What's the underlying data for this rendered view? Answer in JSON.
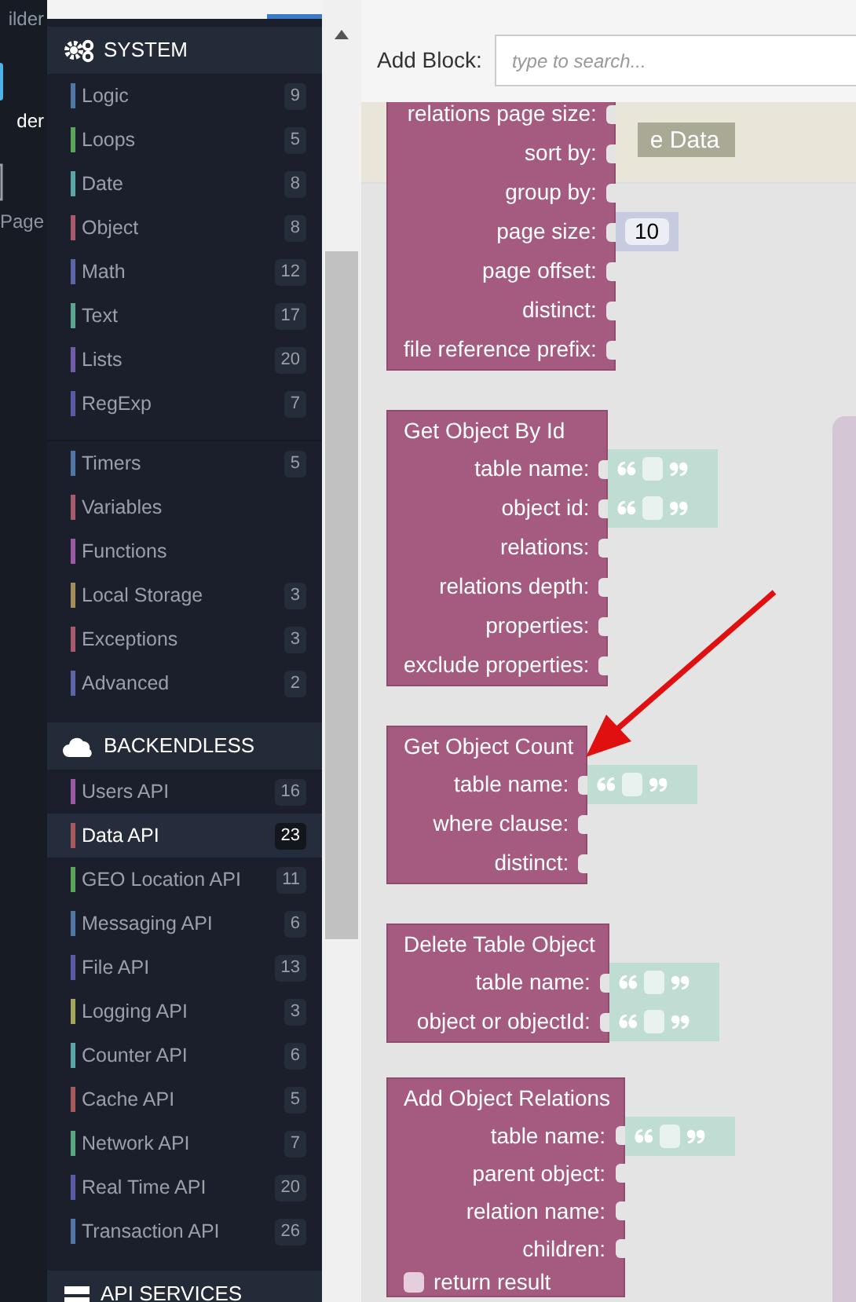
{
  "app_nav": [
    {
      "label": "ilder",
      "selected": false
    },
    {
      "label": "der",
      "selected": true
    },
    {
      "label": "Page",
      "selected": false
    }
  ],
  "sidebar": {
    "sections": [
      {
        "title": "SYSTEM",
        "groups": [
          [
            {
              "label": "Logic",
              "count": "9",
              "color": "#4f76a5",
              "selected": false
            },
            {
              "label": "Loops",
              "count": "5",
              "color": "#5ba55b",
              "selected": false
            },
            {
              "label": "Date",
              "count": "8",
              "color": "#5ba5a5",
              "selected": false
            },
            {
              "label": "Object",
              "count": "8",
              "color": "#a55b6b",
              "selected": false
            },
            {
              "label": "Math",
              "count": "12",
              "color": "#5b67a5",
              "selected": false
            },
            {
              "label": "Text",
              "count": "17",
              "color": "#5ba58c",
              "selected": false
            },
            {
              "label": "Lists",
              "count": "20",
              "color": "#745ba5",
              "selected": false
            },
            {
              "label": "RegExp",
              "count": "7",
              "color": "#5b5ba5",
              "selected": false
            }
          ],
          [
            {
              "label": "Timers",
              "count": "5",
              "color": "#4f76a5",
              "selected": false
            },
            {
              "label": "Variables",
              "color": "#a55b6b",
              "selected": false
            },
            {
              "label": "Functions",
              "color": "#9a5ba5",
              "selected": false
            },
            {
              "label": "Local Storage",
              "count": "3",
              "color": "#a58c5b",
              "selected": false
            },
            {
              "label": "Exceptions",
              "count": "3",
              "color": "#a55b6b",
              "selected": false
            },
            {
              "label": "Advanced",
              "count": "2",
              "color": "#5b67a5",
              "selected": false
            }
          ]
        ]
      },
      {
        "title": "BACKENDLESS",
        "groups": [
          [
            {
              "label": "Users API",
              "count": "16",
              "color": "#9a5ba5",
              "selected": false
            },
            {
              "label": "Data API",
              "count": "23",
              "color": "#a55b5b",
              "selected": true
            },
            {
              "label": "GEO Location API",
              "count": "11",
              "color": "#5ba55b",
              "selected": false
            },
            {
              "label": "Messaging API",
              "count": "6",
              "color": "#4f76a5",
              "selected": false
            },
            {
              "label": "File API",
              "count": "13",
              "color": "#5b5ba5",
              "selected": false
            },
            {
              "label": "Logging API",
              "count": "3",
              "color": "#a5a55b",
              "selected": false
            },
            {
              "label": "Counter API",
              "count": "6",
              "color": "#5ba5a5",
              "selected": false
            },
            {
              "label": "Cache API",
              "count": "5",
              "color": "#a55b5b",
              "selected": false
            },
            {
              "label": "Network API",
              "count": "7",
              "color": "#5ba580",
              "selected": false
            },
            {
              "label": "Real Time API",
              "count": "20",
              "color": "#5b5ba5",
              "selected": false
            },
            {
              "label": "Transaction API",
              "count": "26",
              "color": "#4f76a5",
              "selected": false
            }
          ]
        ]
      },
      {
        "title": "API SERVICES"
      }
    ]
  },
  "toolbar": {
    "label": "Add Block:",
    "placeholder": "type to search..."
  },
  "canvas": {
    "background_button": "e Data",
    "blocks": [
      {
        "inputs": [
          {
            "label": "relations page size:"
          },
          {
            "label": "sort by:"
          },
          {
            "label": "group by:"
          },
          {
            "label": "page size:",
            "kind": "number",
            "value": "10"
          },
          {
            "label": "page offset:"
          },
          {
            "label": "distinct:"
          },
          {
            "label": "file reference prefix:"
          }
        ]
      },
      {
        "title": "Get Object By Id",
        "inputs": [
          {
            "label": "table name:",
            "kind": "text"
          },
          {
            "label": "object id:",
            "kind": "text"
          },
          {
            "label": "relations:"
          },
          {
            "label": "relations depth:"
          },
          {
            "label": "properties:"
          },
          {
            "label": "exclude properties:"
          }
        ]
      },
      {
        "title": "Get Object Count",
        "inputs": [
          {
            "label": "table name:",
            "kind": "text"
          },
          {
            "label": "where clause:"
          },
          {
            "label": "distinct:"
          }
        ]
      },
      {
        "title": "Delete Table Object",
        "inputs": [
          {
            "label": "table name:",
            "kind": "text"
          },
          {
            "label": "object or objectId:",
            "kind": "text"
          }
        ]
      },
      {
        "title": "Add Object Relations",
        "inputs": [
          {
            "label": "table name:",
            "kind": "text"
          },
          {
            "label": "parent object:"
          },
          {
            "label": "relation name:"
          },
          {
            "label": "children:"
          }
        ],
        "option": {
          "label": "return result",
          "checked": false
        }
      }
    ]
  }
}
